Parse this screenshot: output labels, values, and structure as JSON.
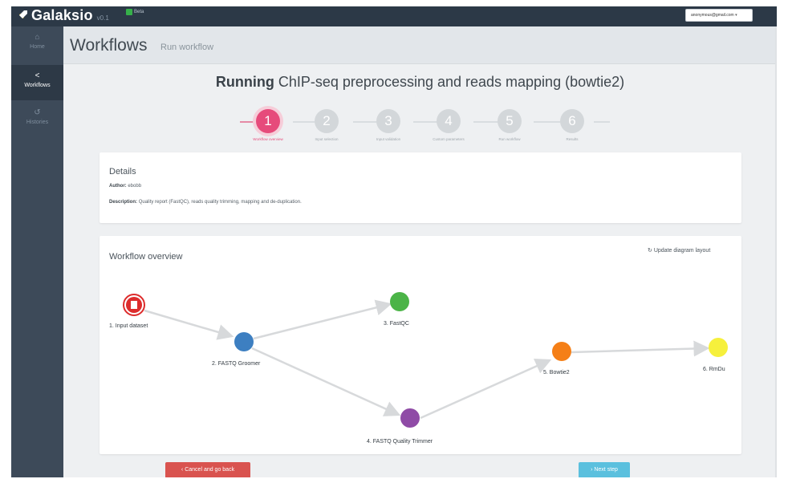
{
  "app": {
    "name": "Galaksio",
    "version": "v0.1",
    "badge": "Beta",
    "user_email": "anonymous@gmail.com"
  },
  "sidebar": {
    "items": [
      {
        "label": "Home",
        "icon": "home-icon",
        "active": false
      },
      {
        "label": "Workflows",
        "icon": "share-icon",
        "active": true
      },
      {
        "label": "Histories",
        "icon": "history-icon",
        "active": false
      }
    ]
  },
  "header": {
    "title": "Workflows",
    "subtitle": "Run workflow"
  },
  "run": {
    "prefix": "Running",
    "workflow_name": "ChIP-seq preprocessing and reads mapping (bowtie2)"
  },
  "steps": [
    {
      "number": "1",
      "label": "Workflow overview",
      "active": true
    },
    {
      "number": "2",
      "label": "Input selection",
      "active": false
    },
    {
      "number": "3",
      "label": "Input validation",
      "active": false
    },
    {
      "number": "4",
      "label": "Custom parameters",
      "active": false
    },
    {
      "number": "5",
      "label": "Run workflow",
      "active": false
    },
    {
      "number": "6",
      "label": "Results",
      "active": false
    }
  ],
  "details": {
    "heading": "Details",
    "author_label": "Author:",
    "author_value": "ebobb",
    "description_label": "Description:",
    "description_value": "Quality report (FastQC), reads quality trimming, mapping and de-duplication."
  },
  "overview": {
    "heading": "Workflow overview",
    "relayout_label": "Update diagram layout",
    "nodes": [
      {
        "id": "n1",
        "label": "1. Input dataset",
        "color": "#dd2c2c"
      },
      {
        "id": "n2",
        "label": "2. FASTQ Groomer",
        "color": "#3d7fc1"
      },
      {
        "id": "n3",
        "label": "3. FastQC",
        "color": "#4bb447"
      },
      {
        "id": "n4",
        "label": "4. FASTQ Quality Trimmer",
        "color": "#8f4ba6"
      },
      {
        "id": "n5",
        "label": "5. Bowtie2",
        "color": "#f57f17"
      },
      {
        "id": "n6",
        "label": "6. RmDu",
        "color": "#f6f03c"
      }
    ]
  },
  "actions": {
    "cancel_label": "Cancel and go back",
    "next_label": "Next step"
  },
  "colors": {
    "topbar": "#2c3947",
    "sidebar": "#3d4a59",
    "step_active": "#e64b7b",
    "cancel": "#d9534f",
    "next": "#5bc0de"
  }
}
